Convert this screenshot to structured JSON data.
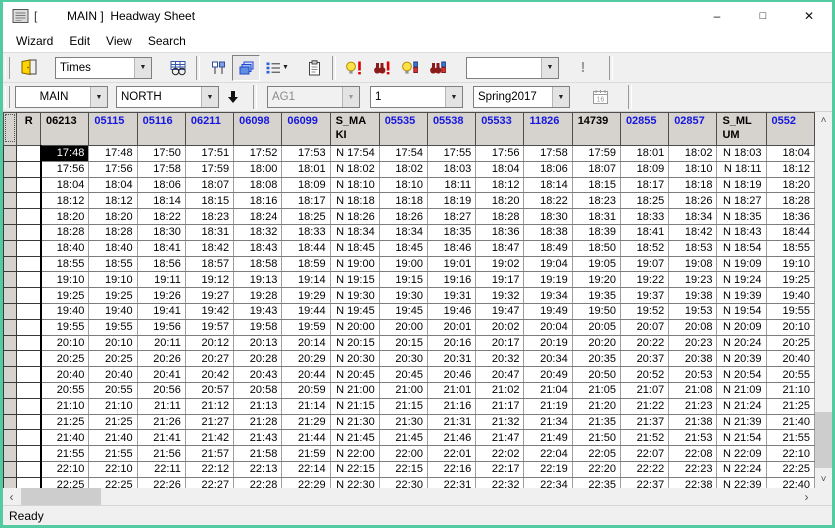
{
  "window": {
    "title_bracket": "[",
    "title": "MAIN ]  Headway Sheet",
    "controls": {
      "minimize": "–",
      "maximize": "□",
      "close": "✕"
    }
  },
  "menu": {
    "items": [
      "Wizard",
      "Edit",
      "View",
      "Search"
    ]
  },
  "toolbar1": {
    "exit_icon": "exit-door-icon",
    "view_combo": {
      "value": "Times"
    },
    "icon_buttons": [
      "grid-browse",
      "timepoint-markers",
      "cascade-layers",
      "list-options",
      "clipboard",
      "bulb-alert",
      "find-alert",
      "bulb-levels",
      "find-levels"
    ],
    "search_combo": {
      "value": ""
    },
    "alert_button_label": "!"
  },
  "toolbar2": {
    "route_combo": {
      "value": "MAIN"
    },
    "direction_combo": {
      "value": "NORTH"
    },
    "down_arrow_icon": "down-arrow-icon",
    "agency_combo": {
      "value": "AG1",
      "disabled": true
    },
    "service_combo": {
      "value": "1"
    },
    "booking_combo": {
      "value": "Spring2017"
    },
    "calendar_label": "16"
  },
  "grid": {
    "row_flag_header": "R",
    "colors": {
      "header_black": "#000000",
      "header_blue": "#1616e0"
    },
    "columns": [
      {
        "label": "06213",
        "color": "#000000"
      },
      {
        "label": "05115",
        "color": "#1616e0"
      },
      {
        "label": "05116",
        "color": "#1616e0"
      },
      {
        "label": "06211",
        "color": "#1616e0"
      },
      {
        "label": "06098",
        "color": "#1616e0"
      },
      {
        "label": "06099",
        "color": "#1616e0"
      },
      {
        "label": "S_MAKI",
        "color": "#000000"
      },
      {
        "label": "05535",
        "color": "#1616e0"
      },
      {
        "label": "05538",
        "color": "#1616e0"
      },
      {
        "label": "05533",
        "color": "#1616e0"
      },
      {
        "label": "11826",
        "color": "#1616e0"
      },
      {
        "label": "14739",
        "color": "#000000"
      },
      {
        "label": "02855",
        "color": "#1616e0"
      },
      {
        "label": "02857",
        "color": "#1616e0"
      },
      {
        "label": "S_MLUM",
        "color": "#000000"
      },
      {
        "label": "0552",
        "color": "#1616e0"
      }
    ],
    "selected": {
      "row": 0,
      "col": 0
    },
    "rows": [
      [
        "17:48",
        "17:48",
        "17:50",
        "17:51",
        "17:52",
        "17:53",
        "N 17:54",
        "17:54",
        "17:55",
        "17:56",
        "17:58",
        "17:59",
        "18:01",
        "18:02",
        "N 18:03",
        "18:04"
      ],
      [
        "17:56",
        "17:56",
        "17:58",
        "17:59",
        "18:00",
        "18:01",
        "N 18:02",
        "18:02",
        "18:03",
        "18:04",
        "18:06",
        "18:07",
        "18:09",
        "18:10",
        "N 18:11",
        "18:12"
      ],
      [
        "18:04",
        "18:04",
        "18:06",
        "18:07",
        "18:08",
        "18:09",
        "N 18:10",
        "18:10",
        "18:11",
        "18:12",
        "18:14",
        "18:15",
        "18:17",
        "18:18",
        "N 18:19",
        "18:20"
      ],
      [
        "18:12",
        "18:12",
        "18:14",
        "18:15",
        "18:16",
        "18:17",
        "N 18:18",
        "18:18",
        "18:19",
        "18:20",
        "18:22",
        "18:23",
        "18:25",
        "18:26",
        "N 18:27",
        "18:28"
      ],
      [
        "18:20",
        "18:20",
        "18:22",
        "18:23",
        "18:24",
        "18:25",
        "N 18:26",
        "18:26",
        "18:27",
        "18:28",
        "18:30",
        "18:31",
        "18:33",
        "18:34",
        "N 18:35",
        "18:36"
      ],
      [
        "18:28",
        "18:28",
        "18:30",
        "18:31",
        "18:32",
        "18:33",
        "N 18:34",
        "18:34",
        "18:35",
        "18:36",
        "18:38",
        "18:39",
        "18:41",
        "18:42",
        "N 18:43",
        "18:44"
      ],
      [
        "18:40",
        "18:40",
        "18:41",
        "18:42",
        "18:43",
        "18:44",
        "N 18:45",
        "18:45",
        "18:46",
        "18:47",
        "18:49",
        "18:50",
        "18:52",
        "18:53",
        "N 18:54",
        "18:55"
      ],
      [
        "18:55",
        "18:55",
        "18:56",
        "18:57",
        "18:58",
        "18:59",
        "N 19:00",
        "19:00",
        "19:01",
        "19:02",
        "19:04",
        "19:05",
        "19:07",
        "19:08",
        "N 19:09",
        "19:10"
      ],
      [
        "19:10",
        "19:10",
        "19:11",
        "19:12",
        "19:13",
        "19:14",
        "N 19:15",
        "19:15",
        "19:16",
        "19:17",
        "19:19",
        "19:20",
        "19:22",
        "19:23",
        "N 19:24",
        "19:25"
      ],
      [
        "19:25",
        "19:25",
        "19:26",
        "19:27",
        "19:28",
        "19:29",
        "N 19:30",
        "19:30",
        "19:31",
        "19:32",
        "19:34",
        "19:35",
        "19:37",
        "19:38",
        "N 19:39",
        "19:40"
      ],
      [
        "19:40",
        "19:40",
        "19:41",
        "19:42",
        "19:43",
        "19:44",
        "N 19:45",
        "19:45",
        "19:46",
        "19:47",
        "19:49",
        "19:50",
        "19:52",
        "19:53",
        "N 19:54",
        "19:55"
      ],
      [
        "19:55",
        "19:55",
        "19:56",
        "19:57",
        "19:58",
        "19:59",
        "N 20:00",
        "20:00",
        "20:01",
        "20:02",
        "20:04",
        "20:05",
        "20:07",
        "20:08",
        "N 20:09",
        "20:10"
      ],
      [
        "20:10",
        "20:10",
        "20:11",
        "20:12",
        "20:13",
        "20:14",
        "N 20:15",
        "20:15",
        "20:16",
        "20:17",
        "20:19",
        "20:20",
        "20:22",
        "20:23",
        "N 20:24",
        "20:25"
      ],
      [
        "20:25",
        "20:25",
        "20:26",
        "20:27",
        "20:28",
        "20:29",
        "N 20:30",
        "20:30",
        "20:31",
        "20:32",
        "20:34",
        "20:35",
        "20:37",
        "20:38",
        "N 20:39",
        "20:40"
      ],
      [
        "20:40",
        "20:40",
        "20:41",
        "20:42",
        "20:43",
        "20:44",
        "N 20:45",
        "20:45",
        "20:46",
        "20:47",
        "20:49",
        "20:50",
        "20:52",
        "20:53",
        "N 20:54",
        "20:55"
      ],
      [
        "20:55",
        "20:55",
        "20:56",
        "20:57",
        "20:58",
        "20:59",
        "N 21:00",
        "21:00",
        "21:01",
        "21:02",
        "21:04",
        "21:05",
        "21:07",
        "21:08",
        "N 21:09",
        "21:10"
      ],
      [
        "21:10",
        "21:10",
        "21:11",
        "21:12",
        "21:13",
        "21:14",
        "N 21:15",
        "21:15",
        "21:16",
        "21:17",
        "21:19",
        "21:20",
        "21:22",
        "21:23",
        "N 21:24",
        "21:25"
      ],
      [
        "21:25",
        "21:25",
        "21:26",
        "21:27",
        "21:28",
        "21:29",
        "N 21:30",
        "21:30",
        "21:31",
        "21:32",
        "21:34",
        "21:35",
        "21:37",
        "21:38",
        "N 21:39",
        "21:40"
      ],
      [
        "21:40",
        "21:40",
        "21:41",
        "21:42",
        "21:43",
        "21:44",
        "N 21:45",
        "21:45",
        "21:46",
        "21:47",
        "21:49",
        "21:50",
        "21:52",
        "21:53",
        "N 21:54",
        "21:55"
      ],
      [
        "21:55",
        "21:55",
        "21:56",
        "21:57",
        "21:58",
        "21:59",
        "N 22:00",
        "22:00",
        "22:01",
        "22:02",
        "22:04",
        "22:05",
        "22:07",
        "22:08",
        "N 22:09",
        "22:10"
      ],
      [
        "22:10",
        "22:10",
        "22:11",
        "22:12",
        "22:13",
        "22:14",
        "N 22:15",
        "22:15",
        "22:16",
        "22:17",
        "22:19",
        "22:20",
        "22:22",
        "22:23",
        "N 22:24",
        "22:25"
      ],
      [
        "22:25",
        "22:25",
        "22:26",
        "22:27",
        "22:28",
        "22:29",
        "N 22:30",
        "22:30",
        "22:31",
        "22:32",
        "22:34",
        "22:35",
        "22:37",
        "22:38",
        "N 22:39",
        "22:40"
      ]
    ]
  },
  "status": {
    "text": "Ready"
  }
}
